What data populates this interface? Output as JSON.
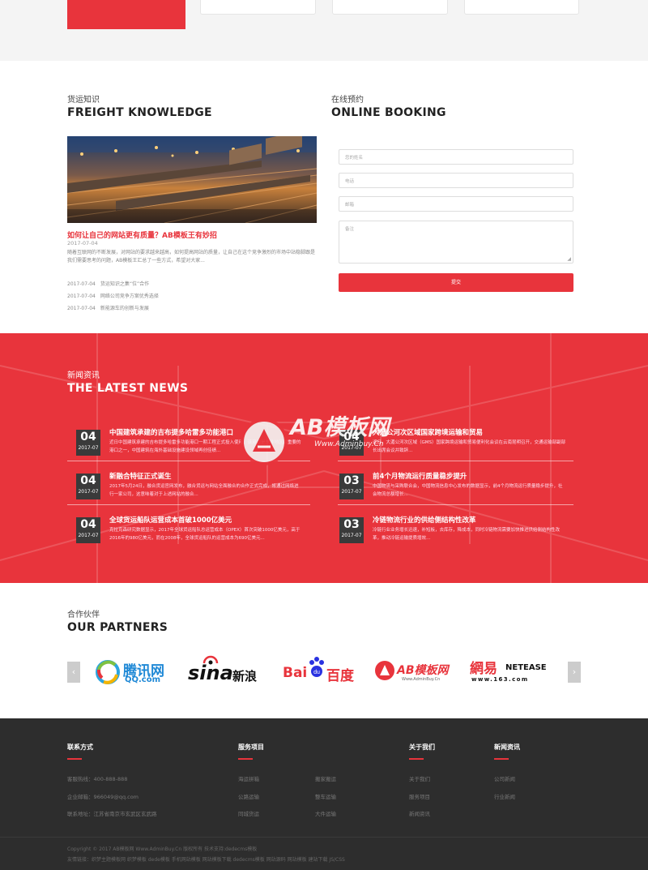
{
  "knowledge": {
    "cn": "货运知识",
    "en": "FREIGHT KNOWLEDGE",
    "featured_title": "如何让自己的网站更有质量？AB模板王有妙招",
    "featured_date": "2017-07-04",
    "featured_desc": "随着互联网的不断发展，对网站的要求越来越高，如何提高网站的质量，让自己在这个竞争激烈的市场中站稳脚跟是我们需要思考的问题，AB模板王汇总了一些方式，希望对大家...",
    "list": [
      {
        "date": "2017-07-04",
        "title": "货运知识之集“位”合作"
      },
      {
        "date": "2017-07-04",
        "title": "网络公司竞争方案优秀选择"
      },
      {
        "date": "2017-07-04",
        "title": "新能源车的创新与发展"
      }
    ]
  },
  "booking": {
    "cn": "在线预约",
    "en": "ONLINE BOOKING",
    "name_placeholder": "您的姓名",
    "phone_placeholder": "电话",
    "email_placeholder": "邮箱",
    "note_placeholder": "备注",
    "submit_label": "提交"
  },
  "news": {
    "cn": "新闻资讯",
    "en": "THE LATEST NEWS",
    "left": [
      {
        "day": "04",
        "ym": "2017-07",
        "title": "中国建筑承建的吉布提多哈雷多功能港口",
        "desc": "近日中国建筑承建的吉布提多哈雷多功能港口一期工程正式投入使用，该港口是东非地区最重要的港口之一，中国建筑在海外基础设施建设领域再创佳绩..."
      },
      {
        "day": "04",
        "ym": "2017-07",
        "title": "新融合特征正式诞生",
        "desc": "2017年5月24日，融合货运官网发布，融合货运与网站全面融合的合作正式完成，将通过网络进行一家公司，这意味着对于上述网站的融合..."
      },
      {
        "day": "04",
        "ym": "2017-07",
        "title": "全球货运船队运营成本首破1000亿美元",
        "desc": "克拉克森研究数据显示，2017年全球货运船队总运营成本（OPEX）首次突破1000亿美元，高于2016年的980亿美元，而在2008年，全球货运船队的运营成本为690亿美元..."
      }
    ],
    "right": [
      {
        "day": "04",
        "ym": "2017-07",
        "title": "大湄公河次区域国家跨境运输和贸易",
        "desc": "近日，大湄公河次区域（GMS）国家跨境运输和贸易便利化会议在云南昆明召开，交通运输部副部长出席会议并致辞..."
      },
      {
        "day": "03",
        "ym": "2017-07",
        "title": "前4个月物流运行质量稳步提升",
        "desc": "中国物流与采购联合会，中国物流信息中心发布的数据显示，前4个月物流运行质量稳步提升，社会物流总额增长..."
      },
      {
        "day": "03",
        "ym": "2017-07",
        "title": "冷链物流行业的供给侧结构性改革",
        "desc": "冷链行业业务增长迅速，补短板，去库存，降成本，同时冷链物流需要加快推进供给侧结构性改革，推动冷链运输提质增效..."
      }
    ],
    "watermark_main": "AB模板网",
    "watermark_sub": "Www.Adminbuy.Cn"
  },
  "partners": {
    "cn": "合作伙伴",
    "en": "OUR PARTNERS",
    "logos": [
      {
        "name": "腾讯网",
        "sub": "QQ.com"
      },
      {
        "name": "sina",
        "sub": "新浪"
      },
      {
        "name": "Bai",
        "sub": "百度"
      },
      {
        "name": "AB模板网",
        "sub": "Www.AdminBuy.Cn"
      },
      {
        "name": "網易",
        "sub": "NETEASE",
        "sub2": "www.163.com"
      }
    ]
  },
  "footer": {
    "contact": {
      "title": "联系方式",
      "items": [
        "客服热线：400-888-888",
        "企业邮箱：966049@qq.com",
        "联系地址：江苏省南京市玄武区玄武路"
      ]
    },
    "services": {
      "title": "服务项目",
      "col1": [
        "海运拼箱",
        "公路运输",
        "同城货运"
      ],
      "col2": [
        "搬家搬运",
        "整车运输",
        "大件运输"
      ]
    },
    "about": {
      "title": "关于我们",
      "items": [
        "关于我们",
        "服务项目",
        "新闻资讯"
      ]
    },
    "newsinfo": {
      "title": "新闻资讯",
      "items": [
        "公司新闻",
        "行业新闻"
      ]
    },
    "copyright": "Copyright © 2017 AB模板网 Www.AdminBuy.Cn 版权所有  技术支持:dedecms模板",
    "links": "友情链接：织梦主题模板网  织梦模板  dede模板  手机网站模板  网站模板下载  dedecms模板  网站源码  网站模板  建站下载  JS/CSS"
  },
  "colors": {
    "accent": "#e8343c",
    "footer_bg": "#2d2d2d"
  }
}
